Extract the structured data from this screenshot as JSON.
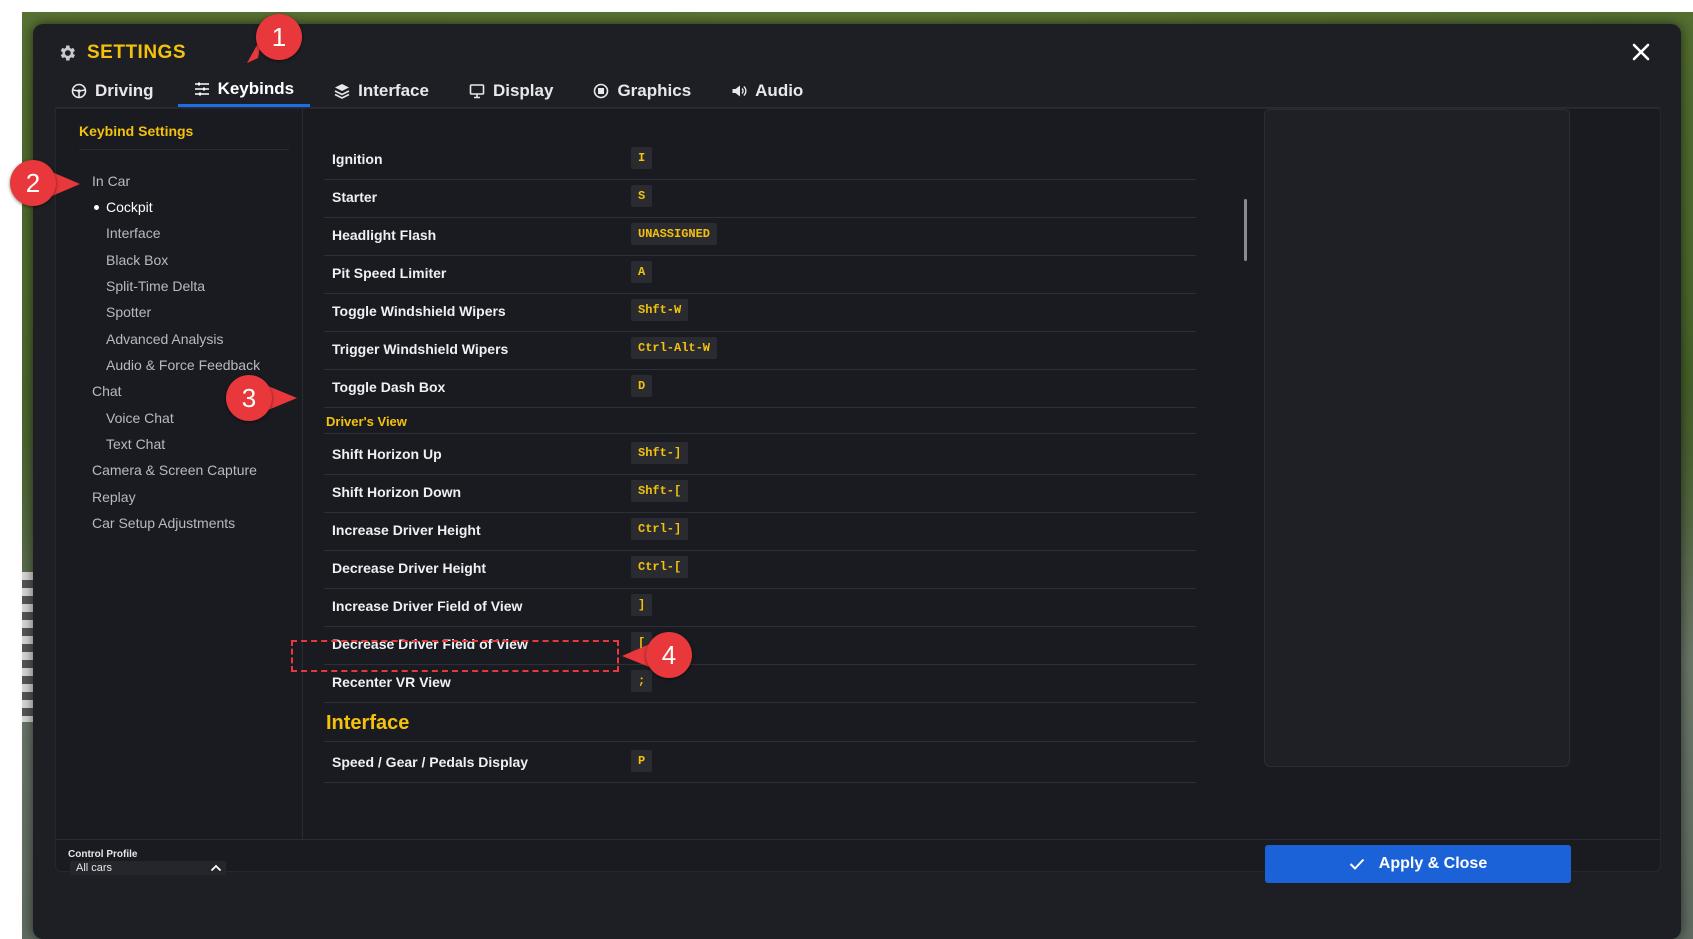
{
  "window": {
    "title": "SETTINGS"
  },
  "tabs": [
    {
      "label": "Driving",
      "icon": "steering-wheel-icon"
    },
    {
      "label": "Keybinds",
      "icon": "keybind-list-icon",
      "active": true
    },
    {
      "label": "Interface",
      "icon": "layers-icon"
    },
    {
      "label": "Display",
      "icon": "monitor-icon"
    },
    {
      "label": "Graphics",
      "icon": "chip-icon"
    },
    {
      "label": "Audio",
      "icon": "speaker-icon"
    }
  ],
  "sidebar": {
    "heading": "Keybind Settings",
    "items": [
      {
        "label": "In Car",
        "level": 1
      },
      {
        "label": "Cockpit",
        "level": 2,
        "selected": true
      },
      {
        "label": "Interface",
        "level": 2
      },
      {
        "label": "Black Box",
        "level": 2
      },
      {
        "label": "Split-Time Delta",
        "level": 2
      },
      {
        "label": "Spotter",
        "level": 2
      },
      {
        "label": "Advanced Analysis",
        "level": 2
      },
      {
        "label": "Audio & Force Feedback",
        "level": 2
      },
      {
        "label": "Chat",
        "level": 1
      },
      {
        "label": "Voice Chat",
        "level": 2
      },
      {
        "label": "Text Chat",
        "level": 2
      },
      {
        "label": "Camera & Screen Capture",
        "level": 1
      },
      {
        "label": "Replay",
        "level": 1
      },
      {
        "label": "Car Setup Adjustments",
        "level": 1
      }
    ]
  },
  "keybinds": {
    "cockpit": [
      {
        "action": "Ignition",
        "key": "I"
      },
      {
        "action": "Starter",
        "key": "S"
      },
      {
        "action": "Headlight Flash",
        "key": "UNASSIGNED"
      },
      {
        "action": "Pit Speed Limiter",
        "key": "A"
      },
      {
        "action": "Toggle Windshield Wipers",
        "key": "Shft-W"
      },
      {
        "action": "Trigger Windshield Wipers",
        "key": "Ctrl-Alt-W"
      },
      {
        "action": "Toggle Dash Box",
        "key": "D"
      }
    ],
    "drivers_view_heading": "Driver's View",
    "drivers_view": [
      {
        "action": "Shift Horizon Up",
        "key": "Shft-]"
      },
      {
        "action": "Shift Horizon Down",
        "key": "Shft-["
      },
      {
        "action": "Increase Driver Height",
        "key": "Ctrl-]"
      },
      {
        "action": "Decrease Driver Height",
        "key": "Ctrl-["
      },
      {
        "action": "Increase Driver Field of View",
        "key": "]"
      },
      {
        "action": "Decrease Driver Field of View",
        "key": "["
      },
      {
        "action": "Recenter VR View",
        "key": ";"
      }
    ],
    "interface_heading": "Interface",
    "interface": [
      {
        "action": "Speed / Gear / Pedals Display",
        "key": "P"
      }
    ]
  },
  "footer": {
    "profile_label": "Control Profile",
    "profile_value": "All cars",
    "apply_label": "Apply & Close"
  },
  "callouts": [
    "1",
    "2",
    "3",
    "4"
  ],
  "colors": {
    "accent_yellow": "#f4c20d",
    "primary_blue": "#1b62d8",
    "callout_red": "#e8383b",
    "window_bg": "#1e1f24"
  }
}
